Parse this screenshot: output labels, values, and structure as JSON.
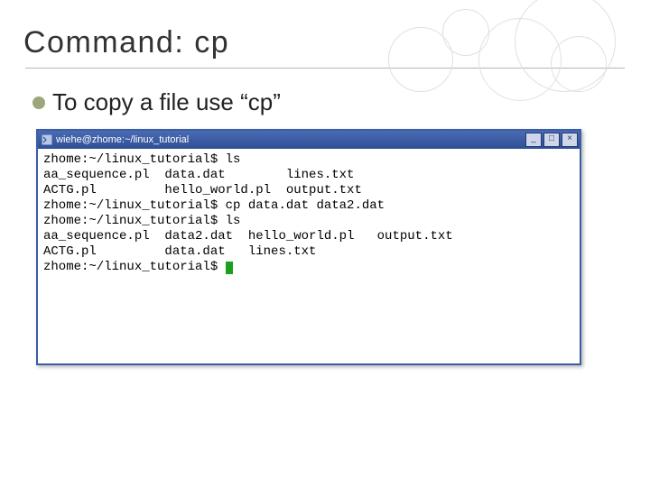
{
  "slide": {
    "title": "Command: cp",
    "bullet": "To copy a file use “cp”"
  },
  "terminal": {
    "titlebar": "wiehe@zhome:~/linux_tutorial",
    "buttons": {
      "min": "_",
      "max": "□",
      "close": "×"
    },
    "content": "zhome:~/linux_tutorial$ ls\naa_sequence.pl  data.dat        lines.txt\nACTG.pl         hello_world.pl  output.txt\nzhome:~/linux_tutorial$ cp data.dat data2.dat\nzhome:~/linux_tutorial$ ls\naa_sequence.pl  data2.dat  hello_world.pl   output.txt\nACTG.pl         data.dat   lines.txt\nzhome:~/linux_tutorial$ "
  }
}
